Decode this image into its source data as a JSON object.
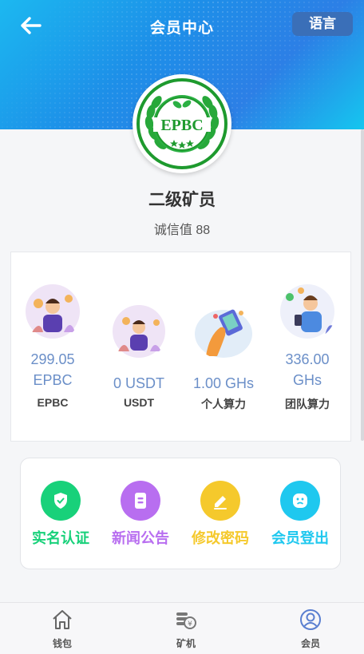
{
  "header": {
    "title": "会员中心",
    "language_label": "语言"
  },
  "logo": {
    "text": "EPBC"
  },
  "profile": {
    "rank": "二级矿员",
    "credit": "诚信值 88"
  },
  "stats": [
    {
      "value_line1": "299.05",
      "value_line2": "EPBC",
      "label": "EPBC"
    },
    {
      "value_line1": "0 USDT",
      "value_line2": "",
      "label": "USDT"
    },
    {
      "value_line1": "1.00 GHs",
      "value_line2": "",
      "label": "个人算力"
    },
    {
      "value_line1": "336.00",
      "value_line2": "GHs",
      "label": "团队算力"
    }
  ],
  "menu": [
    {
      "label": "实名认证",
      "color": "#18d17a",
      "icon": "shield-icon"
    },
    {
      "label": "新闻公告",
      "color": "#b86ef0",
      "icon": "document-icon"
    },
    {
      "label": "修改密码",
      "color": "#f5c92c",
      "icon": "edit-icon"
    },
    {
      "label": "会员登出",
      "color": "#1fc8ef",
      "icon": "logout-face-icon"
    }
  ],
  "tabs": [
    {
      "label": "钱包",
      "icon": "home-icon"
    },
    {
      "label": "矿机",
      "icon": "coins-icon"
    },
    {
      "label": "会员",
      "icon": "user-icon",
      "active": true
    }
  ],
  "colors": {
    "accent": "#1d8fe8",
    "value_text": "#6b8fc8",
    "active_tab": "#5a7fd0"
  }
}
